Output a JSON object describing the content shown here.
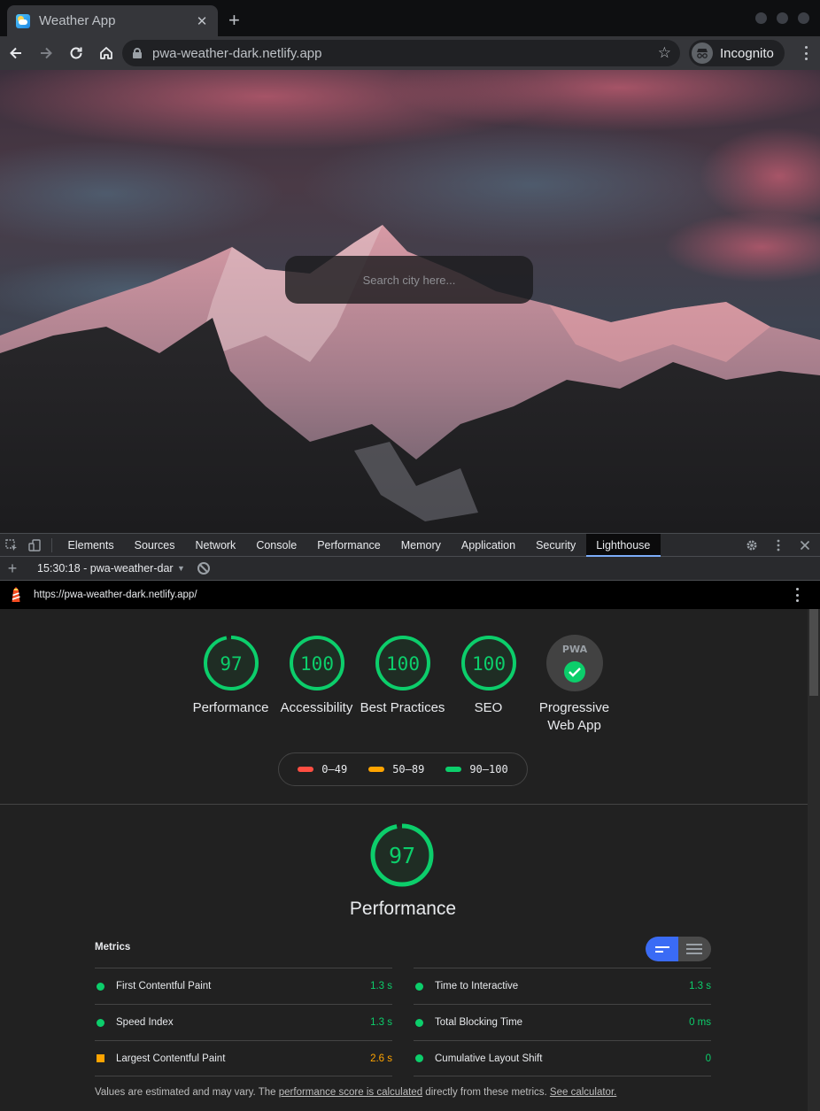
{
  "browser": {
    "tab_title": "Weather App",
    "tab_close": "✕",
    "new_tab": "+",
    "url": "pwa-weather-dark.netlify.app",
    "profile_label": "Incognito"
  },
  "page": {
    "search_placeholder": "Search city here..."
  },
  "devtools": {
    "tabs": [
      "Elements",
      "Sources",
      "Network",
      "Console",
      "Performance",
      "Memory",
      "Application",
      "Security",
      "Lighthouse"
    ],
    "active_tab": "Lighthouse",
    "report_selector": "15:30:18 - pwa-weather-dark.netlify.app",
    "new_report": "+"
  },
  "lighthouse": {
    "url": "https://pwa-weather-dark.netlify.app/",
    "categories": [
      {
        "score": 97,
        "label": "Performance"
      },
      {
        "score": 100,
        "label": "Accessibility"
      },
      {
        "score": 100,
        "label": "Best Practices"
      },
      {
        "score": 100,
        "label": "SEO"
      },
      {
        "badge": "PWA",
        "label": "Progressive Web App"
      }
    ],
    "legend": [
      {
        "range": "0–49",
        "color": "#ff4e42"
      },
      {
        "range": "50–89",
        "color": "#ffa400"
      },
      {
        "range": "90–100",
        "color": "#0cce6b"
      }
    ],
    "performance": {
      "score": 97,
      "title": "Performance",
      "metrics_heading": "Metrics",
      "metrics_left": [
        {
          "name": "First Contentful Paint",
          "value": "1.3 s",
          "status": "pass"
        },
        {
          "name": "Speed Index",
          "value": "1.3 s",
          "status": "pass"
        },
        {
          "name": "Largest Contentful Paint",
          "value": "2.6 s",
          "status": "average"
        }
      ],
      "metrics_right": [
        {
          "name": "Time to Interactive",
          "value": "1.3 s",
          "status": "pass"
        },
        {
          "name": "Total Blocking Time",
          "value": "0 ms",
          "status": "pass"
        },
        {
          "name": "Cumulative Layout Shift",
          "value": "0",
          "status": "pass"
        }
      ],
      "footnote_pre": "Values are estimated and may vary. The ",
      "footnote_link1": "performance score is calculated",
      "footnote_mid": " directly from these metrics. ",
      "footnote_link2": "See calculator."
    },
    "colors": {
      "pass": "#0cce6b",
      "average": "#ffa400",
      "fail": "#ff4e42"
    }
  }
}
